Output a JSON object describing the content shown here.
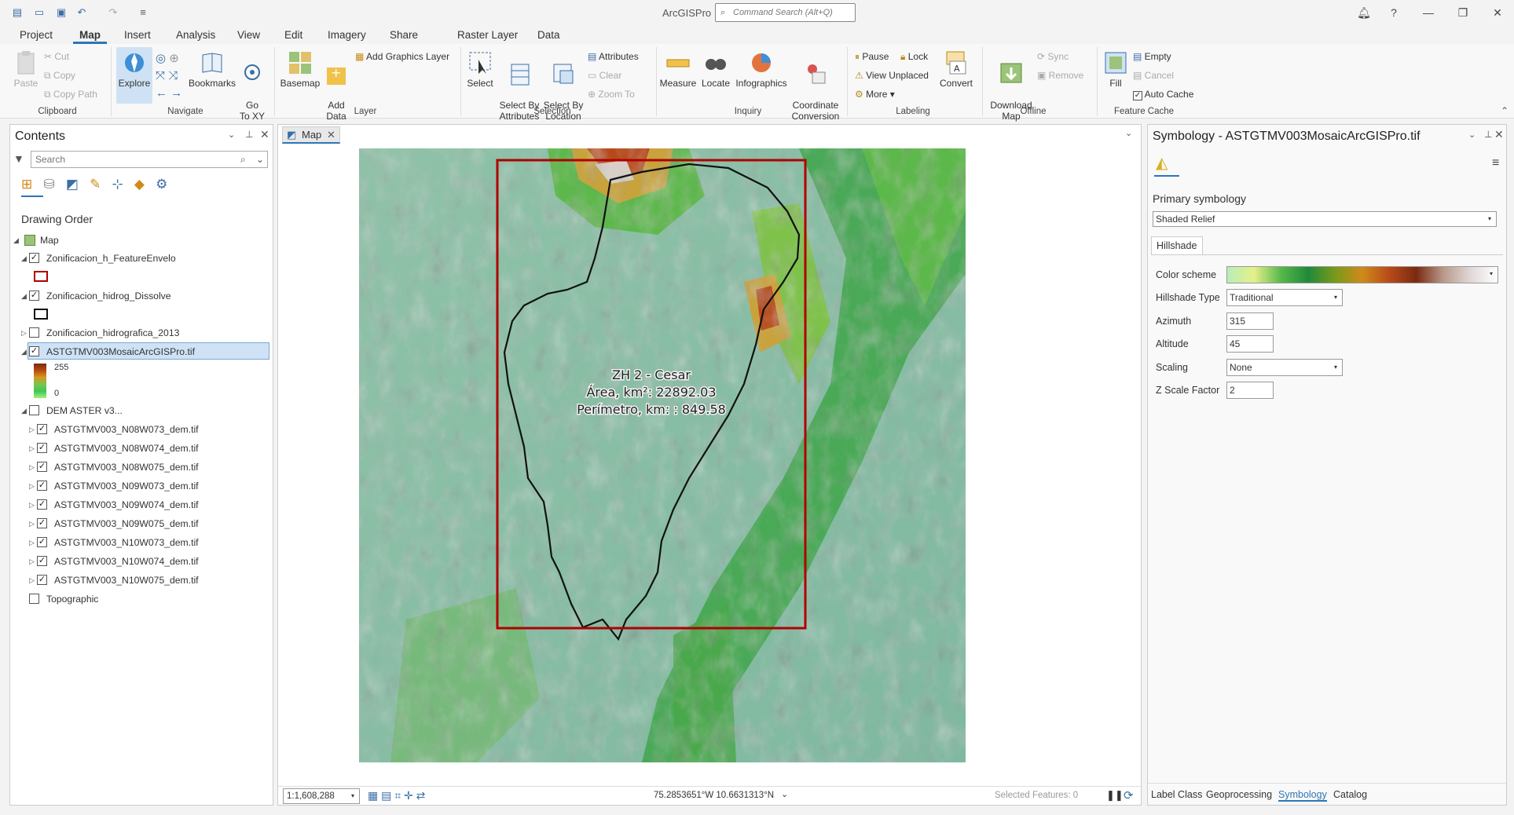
{
  "app": {
    "title": "ArcGISPro",
    "command_search_placeholder": "Command Search (Alt+Q)"
  },
  "ribbon_tabs": [
    "Project",
    "Map",
    "Insert",
    "Analysis",
    "View",
    "Edit",
    "Imagery",
    "Share",
    "Raster Layer",
    "Data"
  ],
  "active_tab": "Map",
  "ribbon": {
    "clipboard": {
      "paste": "Paste",
      "cut": "Cut",
      "copy": "Copy",
      "copy_path": "Copy Path",
      "group": "Clipboard"
    },
    "navigate": {
      "explore": "Explore",
      "bookmarks": "Bookmarks",
      "goto": "Go\nTo XY",
      "group": "Navigate"
    },
    "layer": {
      "basemap": "Basemap",
      "add_data": "Add\nData",
      "add_graphics": "Add Graphics Layer",
      "group": "Layer"
    },
    "selection": {
      "select": "Select",
      "select_by_attr": "Select By\nAttributes",
      "select_by_loc": "Select By\nLocation",
      "attributes": "Attributes",
      "clear": "Clear",
      "zoom_to": "Zoom To",
      "group": "Selection"
    },
    "inquiry": {
      "measure": "Measure",
      "locate": "Locate",
      "infographics": "Infographics",
      "coord": "Coordinate\nConversion",
      "group": "Inquiry"
    },
    "labeling": {
      "pause": "Pause",
      "lock": "Lock",
      "view_unplaced": "View Unplaced",
      "more": "More",
      "convert": "Convert",
      "group": "Labeling"
    },
    "offline": {
      "download": "Download\nMap",
      "sync": "Sync",
      "remove": "Remove",
      "group": "Offline"
    },
    "feature_cache": {
      "fill": "Fill",
      "empty": "Empty",
      "cancel": "Cancel",
      "auto_cache": "Auto Cache",
      "group": "Feature Cache"
    }
  },
  "contents": {
    "title": "Contents",
    "search_placeholder": "Search",
    "drawing_order": "Drawing Order",
    "map_label": "Map",
    "layers": [
      {
        "name": "Zonificacion_h_FeatureEnvelo",
        "checked": true
      },
      {
        "name": "Zonificacion_hidrog_Dissolve",
        "checked": true
      },
      {
        "name": "Zonificacion_hidrografica_2013",
        "checked": false
      },
      {
        "name": "ASTGTMV003MosaicArcGISPro.tif",
        "checked": true
      }
    ],
    "legend_high": "255",
    "legend_low": "0",
    "group_layer": "DEM ASTER v3...",
    "dem_tiles": [
      "ASTGTMV003_N08W073_dem.tif",
      "ASTGTMV003_N08W074_dem.tif",
      "ASTGTMV003_N08W075_dem.tif",
      "ASTGTMV003_N09W073_dem.tif",
      "ASTGTMV003_N09W074_dem.tif",
      "ASTGTMV003_N09W075_dem.tif",
      "ASTGTMV003_N10W073_dem.tif",
      "ASTGTMV003_N10W074_dem.tif",
      "ASTGTMV003_N10W075_dem.tif"
    ],
    "basemap": "Topographic"
  },
  "map": {
    "tab": "Map",
    "label_line1": "ZH 2 - Cesar",
    "label_line2": "Área, km²: 22892.03",
    "label_line3": "Perímetro, km: : 849.58",
    "scale": "1:1,608,288",
    "coordinates": "75.2853651°W 10.6631313°N",
    "selected_features": "Selected Features: 0"
  },
  "symbology": {
    "title": "Symbology - ASTGTMV003MosaicArcGISPro.tif",
    "primary": "Primary symbology",
    "renderer": "Shaded Relief",
    "subtab": "Hillshade",
    "color_scheme_label": "Color scheme",
    "hillshade_type_label": "Hillshade Type",
    "hillshade_type": "Traditional",
    "azimuth_label": "Azimuth",
    "azimuth": "315",
    "altitude_label": "Altitude",
    "altitude": "45",
    "scaling_label": "Scaling",
    "scaling": "None",
    "zscale_label": "Z Scale Factor",
    "zscale": "2",
    "bottom_tabs": [
      "Label Class",
      "Geoprocessing",
      "Symbology",
      "Catalog"
    ]
  },
  "colors": {
    "accent": "#2e75b6",
    "envelope": "#b00000",
    "boundary": "#111111"
  }
}
